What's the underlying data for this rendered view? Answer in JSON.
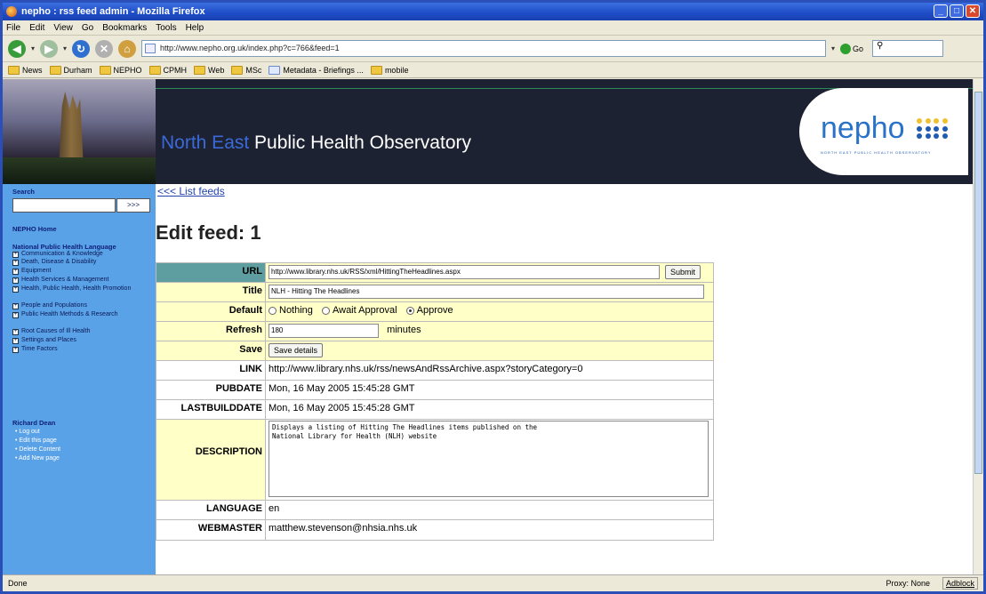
{
  "window": {
    "title": "nepho : rss feed admin - Mozilla Firefox"
  },
  "menu": [
    "File",
    "Edit",
    "View",
    "Go",
    "Bookmarks",
    "Tools",
    "Help"
  ],
  "nav": {
    "url": "http://www.nepho.org.uk/index.php?c=766&feed=1",
    "go_label": "Go",
    "search_value": ""
  },
  "bookmarks": [
    "News",
    "Durham",
    "NEPHO",
    "CPMH",
    "Web",
    "MSc",
    "Metadata - Briefings ...",
    "mobile"
  ],
  "site": {
    "title_prefix": "North East",
    "title_rest": " Public Health Observatory",
    "logo_text": "nepho",
    "logo_tagline": "NORTH EAST PUBLIC HEALTH OBSERVATORY"
  },
  "sidebar": {
    "search_label": "Search",
    "search_button": ">>>",
    "home_link": "NEPHO Home",
    "language_heading": "National Public Health Language",
    "categories": [
      "Communication & Knowledge",
      "Death, Disease & Disability",
      "Equipment",
      "Health Services & Management",
      "Health, Public Health, Health Promotion",
      "People and Populations",
      "Public Health Methods & Research",
      "Root Causes of Ill Health",
      "Settings and Places",
      "Time Factors"
    ],
    "user_name": "Richard Dean",
    "user_links": [
      "Log out",
      "Edit this page",
      "Delete Content",
      "Add New page"
    ]
  },
  "main": {
    "back_link": "<<< List feeds",
    "heading": "Edit feed: 1",
    "labels": {
      "url": "URL",
      "title": "Title",
      "default": "Default",
      "refresh": "Refresh",
      "save": "Save",
      "link": "LINK",
      "pubdate": "PUBDATE",
      "lastbuilddate": "LASTBUILDDATE",
      "description": "DESCRIPTION",
      "language": "LANGUAGE",
      "webmaster": "WEBMASTER"
    },
    "url_value": "http://www.library.nhs.uk/RSS/xml/HittingTheHeadlines.aspx",
    "submit_label": "Submit",
    "title_value": "NLH - Hitting The Headlines",
    "default_options": [
      "Nothing",
      "Await Approval",
      "Approve"
    ],
    "default_selected": "Approve",
    "refresh_value": "180",
    "refresh_unit": "minutes",
    "save_button": "Save details",
    "link_value": "http://www.library.nhs.uk/rss/newsAndRssArchive.aspx?storyCategory=0",
    "pubdate_value": "Mon, 16 May 2005 15:45:28 GMT",
    "lastbuilddate_value": "Mon, 16 May 2005 15:45:28 GMT",
    "description_value": "Displays a listing of Hitting The Headlines items published on the\nNational Library for Health (NLH) website",
    "language_value": "en",
    "webmaster_value": "matthew.stevenson@nhsia.nhs.uk"
  },
  "status": {
    "left": "Done",
    "proxy": "Proxy: None",
    "adblock": "Adblock"
  }
}
